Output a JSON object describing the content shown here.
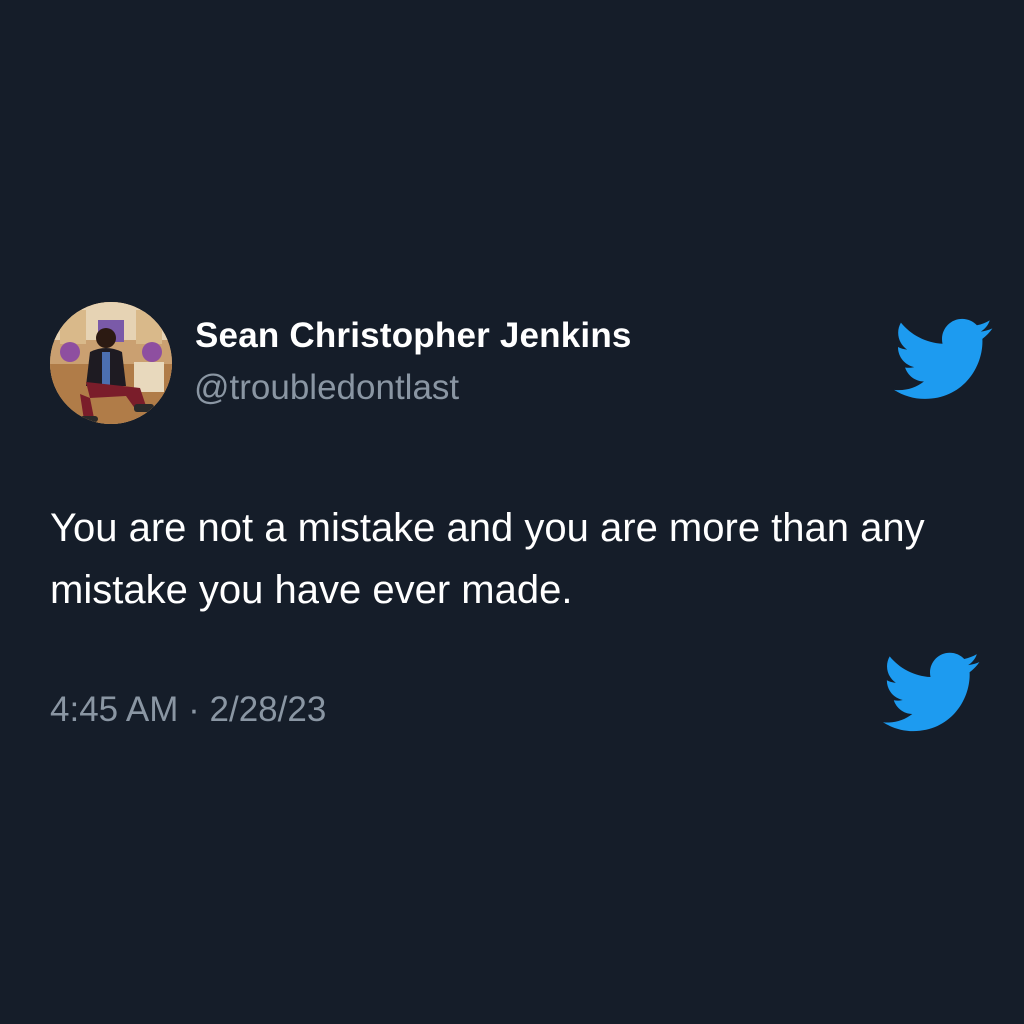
{
  "tweet": {
    "author": {
      "display_name": "Sean Christopher Jenkins",
      "handle": "@troubledontlast",
      "avatar_icon": "profile-photo"
    },
    "text": "You are not a mistake and you are more than any mistake you have ever made.",
    "timestamp": "4:45 AM · 2/28/23"
  },
  "icons": {
    "brand_icon": "twitter-bird-icon"
  },
  "colors": {
    "background": "#151d29",
    "text_primary": "#ffffff",
    "text_secondary": "#8a96a3",
    "brand_blue": "#1d9bf0"
  }
}
